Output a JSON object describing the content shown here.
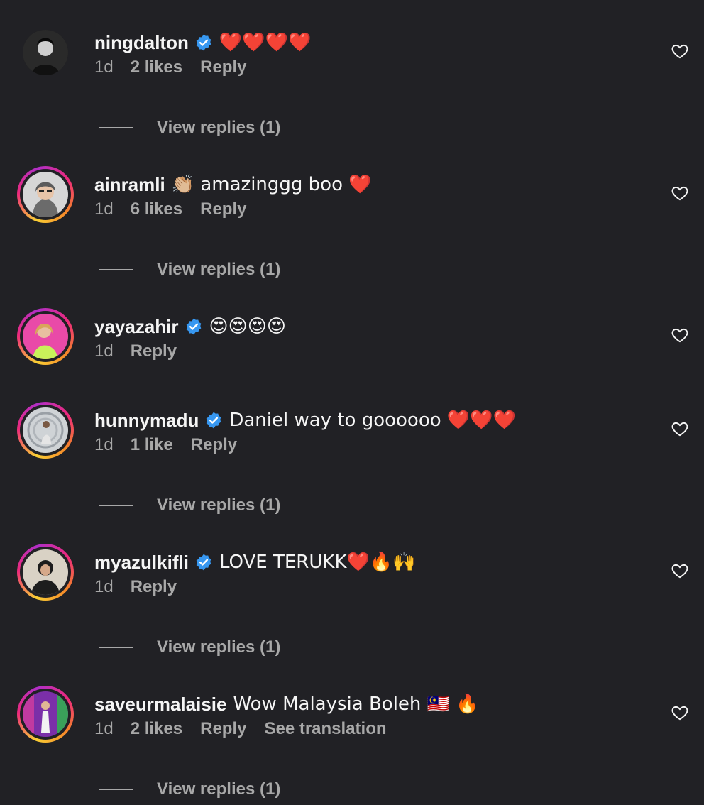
{
  "colors": {
    "background": "#212125",
    "text": "#f5f5f5",
    "secondary_text": "#a8a8a8",
    "verified_badge": "#3797f0"
  },
  "comments": [
    {
      "username": "ningdalton",
      "verified": true,
      "text": "❤️❤️❤️❤️",
      "time": "1d",
      "likes": "2 likes",
      "reply": "Reply",
      "view_replies": "View replies (1)",
      "avatar_icon": "avatar-photo"
    },
    {
      "username": "ainramli",
      "verified": false,
      "text": "👏🏼 amazinggg boo ❤️",
      "time": "1d",
      "likes": "6 likes",
      "reply": "Reply",
      "view_replies": "View replies (1)",
      "avatar_icon": "avatar-photo"
    },
    {
      "username": "yayazahir",
      "verified": true,
      "text": "😍😍😍😍",
      "time": "1d",
      "reply": "Reply",
      "avatar_icon": "avatar-photo"
    },
    {
      "username": "hunnymadu",
      "verified": true,
      "text": "Daniel way to goooooo ❤️❤️❤️",
      "time": "1d",
      "likes": "1 like",
      "reply": "Reply",
      "view_replies": "View replies (1)",
      "avatar_icon": "avatar-photo"
    },
    {
      "username": "myazulkifli",
      "verified": true,
      "text": "LOVE TERUKK❤️🔥🙌",
      "time": "1d",
      "reply": "Reply",
      "view_replies": "View replies (1)",
      "avatar_icon": "avatar-photo"
    },
    {
      "username": "saveurmalaisie",
      "verified": false,
      "text": "Wow Malaysia Boleh 🇲🇾 🔥",
      "time": "1d",
      "likes": "2 likes",
      "reply": "Reply",
      "see_translation": "See translation",
      "view_replies": "View replies (1)",
      "avatar_icon": "avatar-photo"
    }
  ]
}
